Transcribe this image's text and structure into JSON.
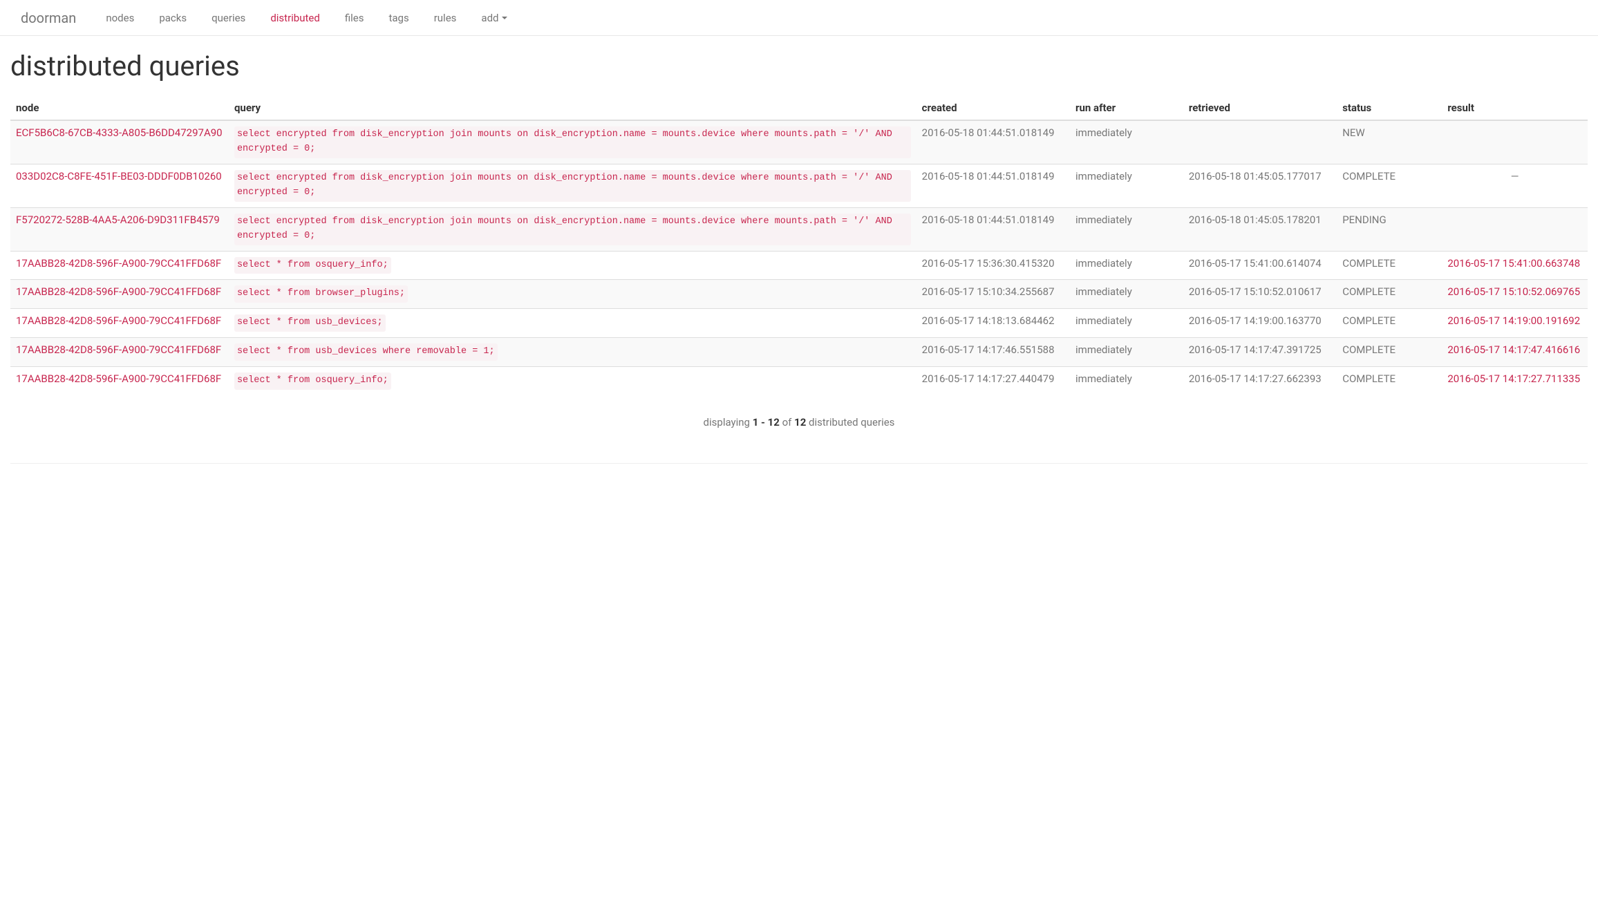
{
  "brand": "doorman",
  "nav": {
    "items": [
      {
        "label": "nodes",
        "active": false
      },
      {
        "label": "packs",
        "active": false
      },
      {
        "label": "queries",
        "active": false
      },
      {
        "label": "distributed",
        "active": true
      },
      {
        "label": "files",
        "active": false
      },
      {
        "label": "tags",
        "active": false
      },
      {
        "label": "rules",
        "active": false
      },
      {
        "label": "add",
        "active": false,
        "dropdown": true
      }
    ]
  },
  "page_title": "distributed queries",
  "table": {
    "headers": {
      "node": "node",
      "query": "query",
      "created": "created",
      "run_after": "run after",
      "retrieved": "retrieved",
      "status": "status",
      "result": "result"
    },
    "rows": [
      {
        "node": "ECF5B6C8-67CB-4333-A805-B6DD47297A90",
        "query": "select encrypted from disk_encryption join mounts on disk_encryption.name = mounts.device where mounts.path = '/' AND encrypted = 0;",
        "created": "2016-05-18 01:44:51.018149",
        "run_after": "immediately",
        "retrieved": "",
        "status": "NEW",
        "result": ""
      },
      {
        "node": "033D02C8-C8FE-451F-BE03-DDDF0DB10260",
        "query": "select encrypted from disk_encryption join mounts on disk_encryption.name = mounts.device where mounts.path = '/' AND encrypted = 0;",
        "created": "2016-05-18 01:44:51.018149",
        "run_after": "immediately",
        "retrieved": "2016-05-18 01:45:05.177017",
        "status": "COMPLETE",
        "result": "—"
      },
      {
        "node": "F5720272-528B-4AA5-A206-D9D311FB4579",
        "query": "select encrypted from disk_encryption join mounts on disk_encryption.name = mounts.device where mounts.path = '/' AND encrypted = 0;",
        "created": "2016-05-18 01:44:51.018149",
        "run_after": "immediately",
        "retrieved": "2016-05-18 01:45:05.178201",
        "status": "PENDING",
        "result": ""
      },
      {
        "node": "17AABB28-42D8-596F-A900-79CC41FFD68F",
        "query": "select * from osquery_info;",
        "created": "2016-05-17 15:36:30.415320",
        "run_after": "immediately",
        "retrieved": "2016-05-17 15:41:00.614074",
        "status": "COMPLETE",
        "result": "2016-05-17 15:41:00.663748"
      },
      {
        "node": "17AABB28-42D8-596F-A900-79CC41FFD68F",
        "query": "select * from browser_plugins;",
        "created": "2016-05-17 15:10:34.255687",
        "run_after": "immediately",
        "retrieved": "2016-05-17 15:10:52.010617",
        "status": "COMPLETE",
        "result": "2016-05-17 15:10:52.069765"
      },
      {
        "node": "17AABB28-42D8-596F-A900-79CC41FFD68F",
        "query": "select * from usb_devices;",
        "created": "2016-05-17 14:18:13.684462",
        "run_after": "immediately",
        "retrieved": "2016-05-17 14:19:00.163770",
        "status": "COMPLETE",
        "result": "2016-05-17 14:19:00.191692"
      },
      {
        "node": "17AABB28-42D8-596F-A900-79CC41FFD68F",
        "query": "select * from usb_devices where removable = 1;",
        "created": "2016-05-17 14:17:46.551588",
        "run_after": "immediately",
        "retrieved": "2016-05-17 14:17:47.391725",
        "status": "COMPLETE",
        "result": "2016-05-17 14:17:47.416616"
      },
      {
        "node": "17AABB28-42D8-596F-A900-79CC41FFD68F",
        "query": "select * from osquery_info;",
        "created": "2016-05-17 14:17:27.440479",
        "run_after": "immediately",
        "retrieved": "2016-05-17 14:17:27.662393",
        "status": "COMPLETE",
        "result": "2016-05-17 14:17:27.711335"
      }
    ]
  },
  "pagination": {
    "prefix": "displaying ",
    "range": "1 - 12",
    "mid": " of ",
    "total": "12",
    "suffix": " distributed queries"
  }
}
